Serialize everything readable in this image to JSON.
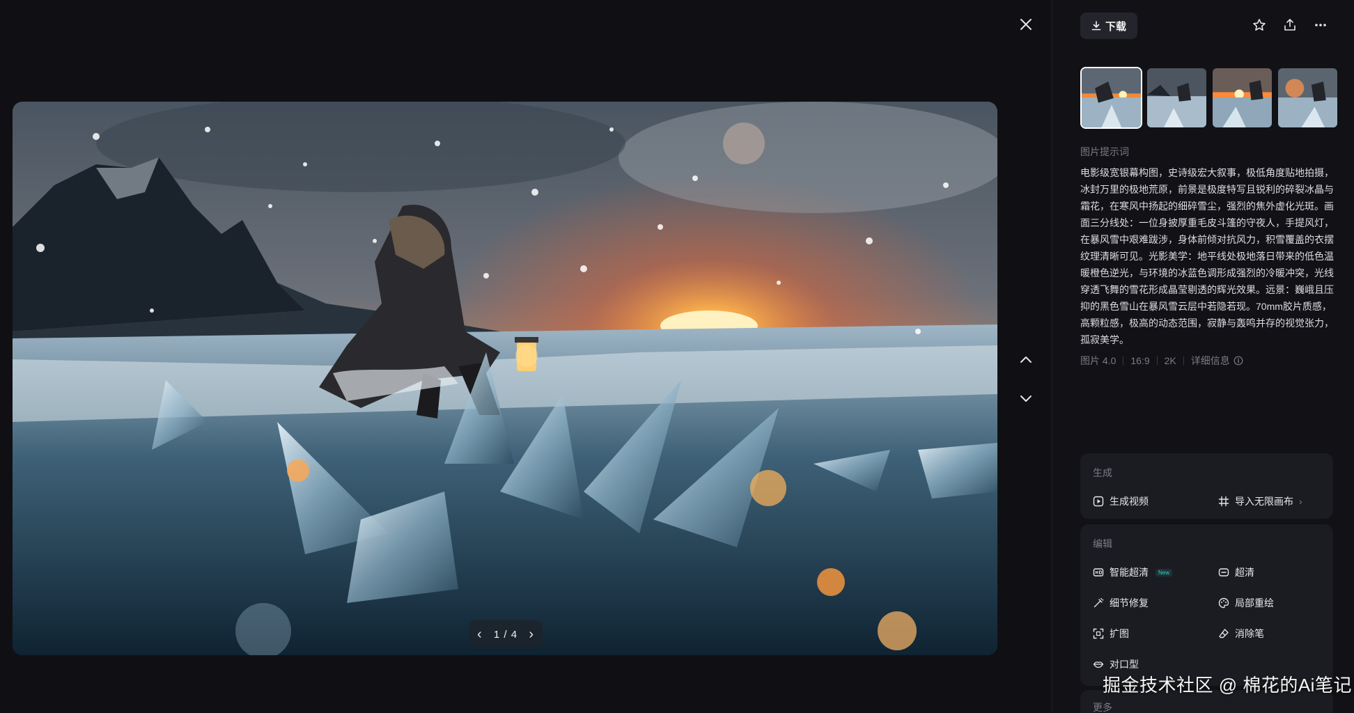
{
  "viewer": {
    "pager": {
      "current": "1",
      "total": "4",
      "separator": "/"
    },
    "icons": {
      "close": "close-icon",
      "prev": "chevron-left-icon",
      "next": "chevron-right-icon",
      "up": "chevron-up-icon",
      "down": "chevron-down-icon"
    }
  },
  "toolbar": {
    "download_label": "下载",
    "icons": [
      "download-icon",
      "star-icon",
      "share-icon",
      "more-icon"
    ]
  },
  "thumbnails": {
    "count": 4,
    "active_index": 0
  },
  "prompt": {
    "title": "图片提示词",
    "lines": [
      "电影级宽银幕构图，史诗级宏大叙事，极低角度贴地拍摄，",
      "冰封万里的极地荒原，前景是极度特写且锐利的碎裂冰晶与",
      "霜花，在寒风中扬起的细碎雪尘，强烈的焦外虚化光斑。画",
      "面三分线处：一位身披厚重毛皮斗篷的守夜人，手提风灯，",
      "在暴风雪中艰难跋涉，身体前倾对抗风力，积雪覆盖的衣摆",
      "纹理清晰可见。光影美学：地平线处极地落日带来的低色温",
      "暖橙色逆光，与环境的冰蓝色调形成强烈的冷暖冲突，光线",
      "穿透飞舞的雪花形成晶莹剔透的辉光效果。远景：巍峨且压",
      "抑的黑色雪山在暴风雪云层中若隐若现。70mm胶片质感，",
      "高颗粒感，极高的动态范围，寂静与轰鸣并存的视觉张力，",
      "孤寂美学。"
    ]
  },
  "meta": {
    "model": "图片 4.0",
    "ratio": "16:9",
    "resolution": "2K",
    "detail_label": "详细信息"
  },
  "generate": {
    "title": "生成",
    "video_label": "生成视频",
    "canvas_label": "导入无限画布"
  },
  "edit": {
    "title": "编辑",
    "smart_hd_label": "智能超清",
    "new_badge": "New",
    "hd_label": "超清",
    "detail_fix_label": "细节修复",
    "inpaint_label": "局部重绘",
    "expand_label": "扩图",
    "eraser_label": "消除笔",
    "lipsync_label": "对口型"
  },
  "more": {
    "title": "更多"
  },
  "watermark": "掘金技术社区 @ 棉花的Ai笔记",
  "colors": {
    "background": "#101014",
    "panel": "#111116",
    "card": "#1b1c22",
    "accent_new": "#2bd6c6",
    "muted_text": "#7b7c85"
  }
}
